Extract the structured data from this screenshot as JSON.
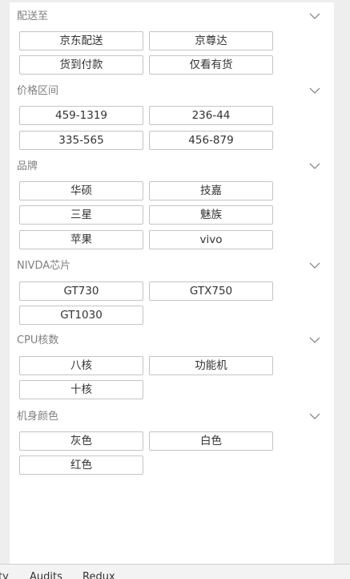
{
  "sections": [
    {
      "title": "配送至",
      "options": [
        "京东配送",
        "京尊达",
        "货到付款",
        "仅看有货"
      ]
    },
    {
      "title": "价格区间",
      "options": [
        "459-1319",
        "236-44",
        "335-565",
        "456-879"
      ]
    },
    {
      "title": "品牌",
      "options": [
        "华硕",
        "技嘉",
        "三星",
        "魅族",
        "苹果",
        "vivo"
      ]
    },
    {
      "title": "NIVDA芯片",
      "options": [
        "GT730",
        "GTX750",
        "GT1030"
      ]
    },
    {
      "title": "CPU核数",
      "options": [
        "八核",
        "功能机",
        "十核"
      ]
    },
    {
      "title": "机身颜色",
      "options": [
        "灰色",
        "白色",
        "红色"
      ]
    }
  ],
  "icons": {
    "section_toggle": "chevron-down-icon"
  },
  "colors": {
    "title": "#808080",
    "option_border": "#c4c4c4",
    "option_text": "#333333",
    "chevron": "#8a8a8a"
  },
  "devtools": {
    "tabs": [
      "ty",
      "Audits",
      "Redux"
    ]
  }
}
